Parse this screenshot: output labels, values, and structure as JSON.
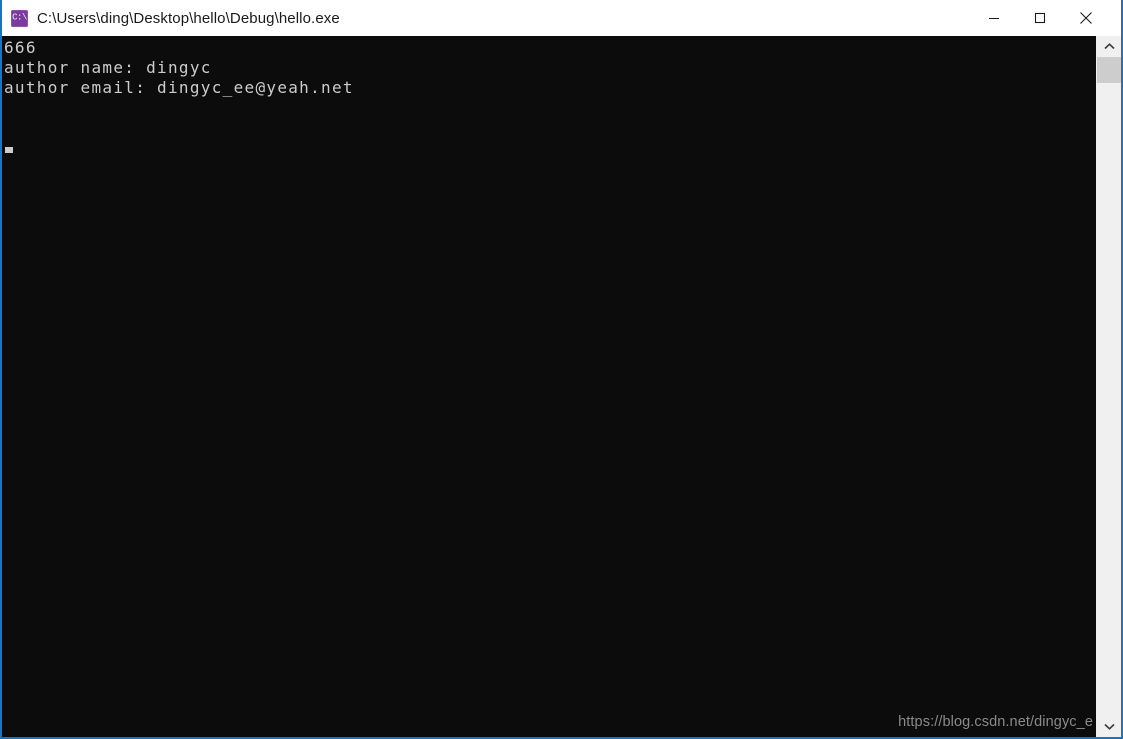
{
  "window": {
    "title": "C:\\Users\\ding\\Desktop\\hello\\Debug\\hello.exe",
    "icon_name": "console-app-icon",
    "icon_glyph": "C:\\",
    "accent_border_color": "#1a74c4",
    "titlebar_bg": "#ffffff",
    "titlebar_text_color": "#1b1b1b"
  },
  "titlebar_buttons": {
    "minimize_label": "Minimize",
    "maximize_label": "Maximize",
    "close_label": "Close"
  },
  "console": {
    "background_color": "#0c0c0c",
    "text_color": "#cccccc",
    "lines": [
      "666",
      "author name: dingyc",
      "author email: dingyc_ee@yeah.net"
    ],
    "output": "666\nauthor name: dingyc\nauthor email: dingyc_ee@yeah.net",
    "cursor_visible": true,
    "cursor_row": 4,
    "cursor_column": 1
  },
  "watermark": {
    "text": "https://blog.csdn.net/dingyc_e",
    "color": "#8a8a8a"
  },
  "scrollbar": {
    "track_color": "#f0f0f0",
    "thumb_color": "#cdcdcd",
    "up_arrow_label": "Scroll up",
    "down_arrow_label": "Scroll down",
    "thumb_position_percent": 0
  }
}
